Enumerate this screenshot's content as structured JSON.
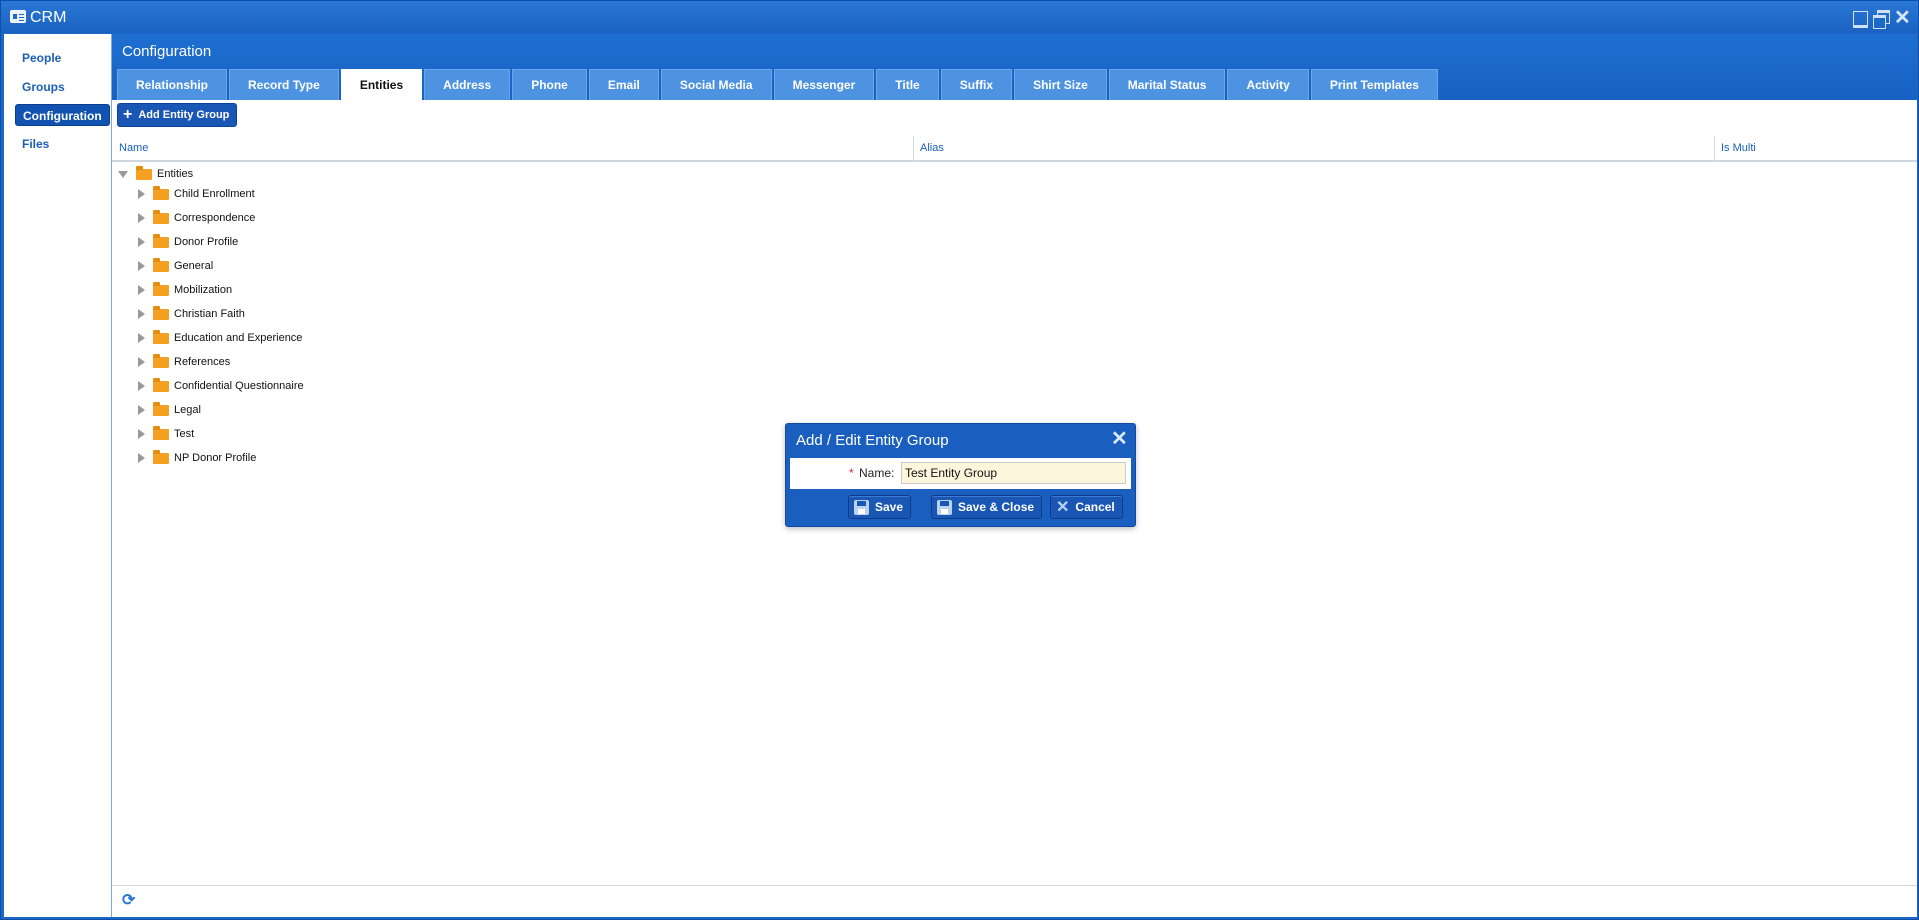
{
  "window": {
    "title": "CRM"
  },
  "sidebar": {
    "items": [
      {
        "label": "People",
        "active": false
      },
      {
        "label": "Groups",
        "active": false
      },
      {
        "label": "Configuration",
        "active": true
      },
      {
        "label": "Files",
        "active": false
      }
    ]
  },
  "main": {
    "title": "Configuration",
    "tabs": [
      "Relationship",
      "Record Type",
      "Entities",
      "Address",
      "Phone",
      "Email",
      "Social Media",
      "Messenger",
      "Title",
      "Suffix",
      "Shirt Size",
      "Marital Status",
      "Activity",
      "Print Templates"
    ],
    "active_tab": "Entities",
    "add_button_label": "Add Entity Group",
    "columns": {
      "name": "Name",
      "alias": "Alias",
      "is_multi": "Is Multi"
    },
    "tree": {
      "root": "Entities",
      "children": [
        "Child Enrollment",
        "Correspondence",
        "Donor Profile",
        "General",
        "Mobilization",
        "Christian Faith",
        "Education and Experience",
        "References",
        "Confidential Questionnaire",
        "Legal",
        "Test",
        "NP Donor Profile"
      ]
    }
  },
  "dialog": {
    "title": "Add / Edit Entity Group",
    "required_marker": "*",
    "name_label": "Name:",
    "name_value": "Test Entity Group",
    "buttons": {
      "save": "Save",
      "save_close": "Save & Close",
      "cancel": "Cancel"
    }
  },
  "icons": {
    "app": "crm-card-icon",
    "window_controls": [
      "minimize-icon",
      "restore-icon",
      "close-icon"
    ],
    "tree_node": "folder-icon",
    "footer": "refresh-icon"
  },
  "colors": {
    "accent": "#1d67c9",
    "active_nav": "#1252b0",
    "tab": "#4d93e2",
    "folder": "#f5a021",
    "input_bg": "#fdf6dd"
  }
}
